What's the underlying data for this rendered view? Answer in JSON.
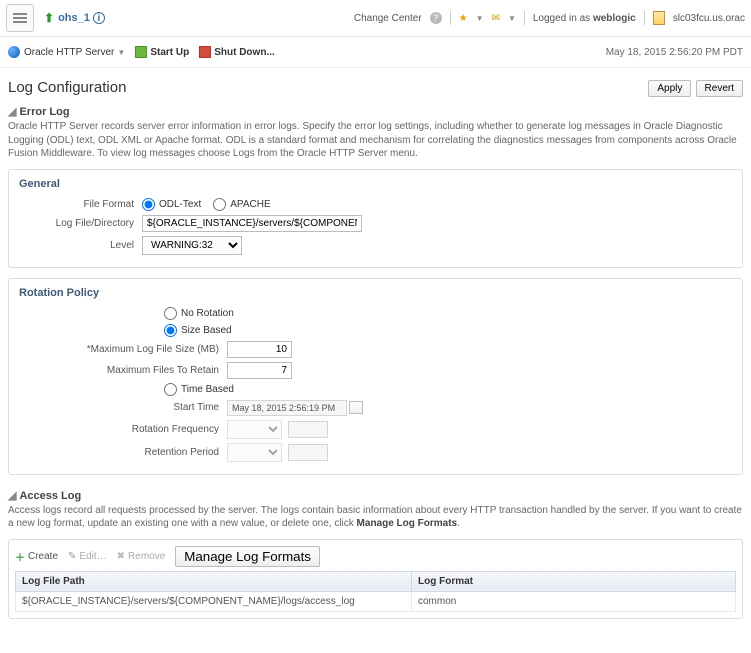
{
  "header": {
    "breadcrumb_name": "ohs_1",
    "change_center": "Change Center",
    "logged_in_prefix": "Logged in as ",
    "logged_in_user": "weblogic",
    "host": "slc03fcu.us.orac"
  },
  "toolbar": {
    "target_menu": "Oracle HTTP Server",
    "start_up": "Start Up",
    "shut_down": "Shut Down...",
    "timestamp": "May 18, 2015 2:56:20 PM PDT"
  },
  "page": {
    "title": "Log Configuration",
    "apply": "Apply",
    "revert": "Revert"
  },
  "error_log": {
    "title": "Error Log",
    "desc_1": "Oracle HTTP Server records server error information in error logs. Specify the error log settings, including whether to generate log messages in Oracle Diagnostic Logging (ODL) text, ODL XML or Apache format. ODL is a standard format and mechanism for correlating the diagnostics messages from components across Oracle Fusion Middleware. To view log messages choose Logs from the Oracle HTTP Server menu.",
    "general_title": "General",
    "file_format_label": "File Format",
    "file_format_odl": "ODL-Text",
    "file_format_apache": "APACHE",
    "log_dir_label": "Log File/Directory",
    "log_dir_value": "${ORACLE_INSTANCE}/servers/${COMPONENT_NAM",
    "level_label": "Level",
    "level_value": "WARNING:32",
    "rotation_title": "Rotation Policy",
    "rot_none": "No Rotation",
    "rot_size": "Size Based",
    "rot_max_size_label": "Maximum Log File Size (MB)",
    "rot_max_size_value": "10",
    "rot_max_files_label": "Maximum Files To Retain",
    "rot_max_files_value": "7",
    "rot_time": "Time Based",
    "start_time_label": "Start Time",
    "start_time_value": "May 18, 2015 2:56:19 PM",
    "rot_freq_label": "Rotation Frequency",
    "ret_period_label": "Retention Period"
  },
  "access_log": {
    "title": "Access Log",
    "desc": "Access logs record all requests processed by the server. The logs contain basic information about every HTTP transaction handled by the server. If you want to create a new log format, update an existing one with a new value, or delete one, click ",
    "desc_link": "Manage Log Formats",
    "create": "Create",
    "edit": "Edit…",
    "remove": "Remove",
    "manage": "Manage Log Formats",
    "col_path": "Log File Path",
    "col_format": "Log Format",
    "row_path": "${ORACLE_INSTANCE}/servers/${COMPONENT_NAME}/logs/access_log",
    "row_format": "common"
  }
}
